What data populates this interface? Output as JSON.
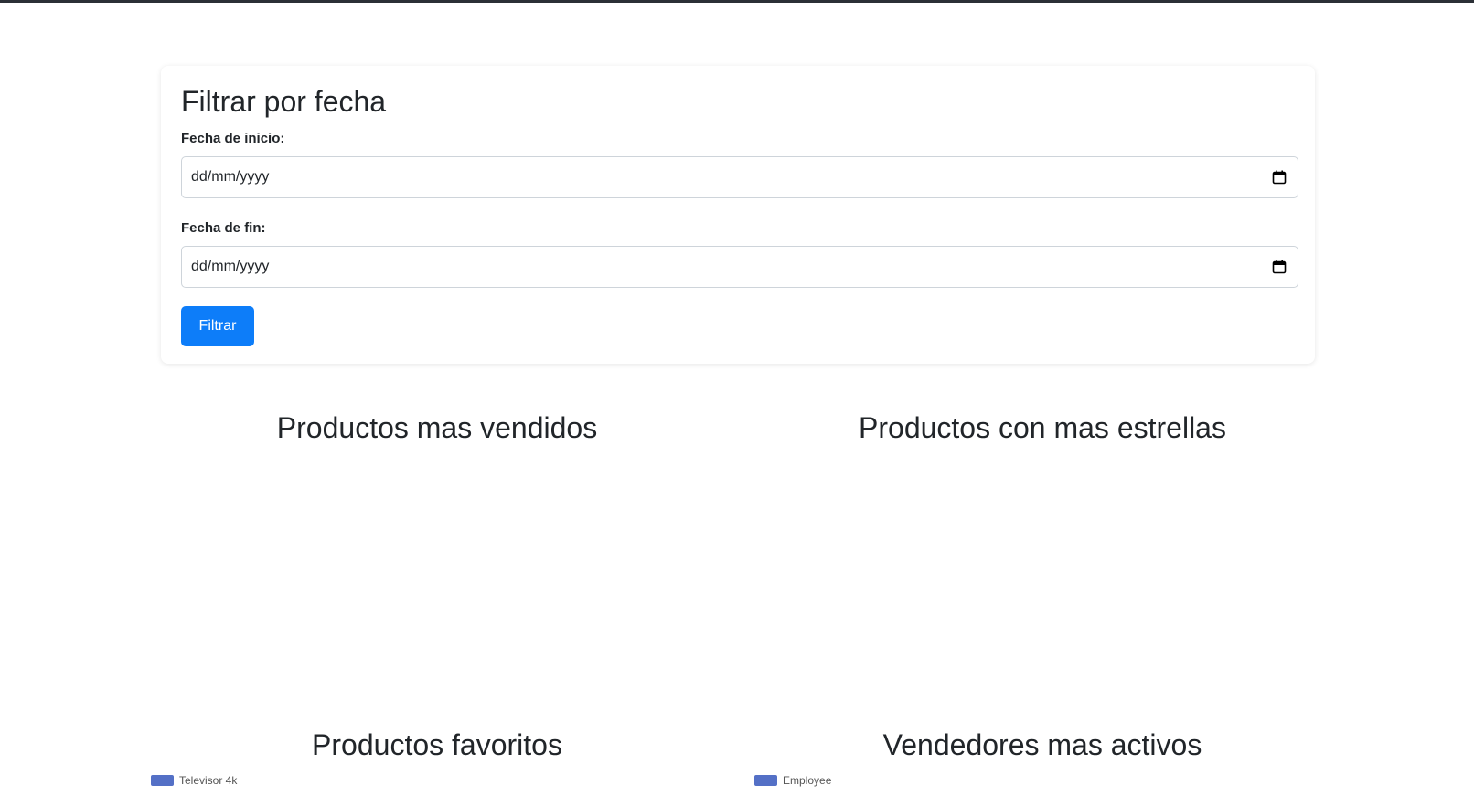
{
  "filter": {
    "title": "Filtrar por fecha",
    "start_label": "Fecha de inicio:",
    "start_placeholder": "dd/mm/yyyy",
    "end_label": "Fecha de fin:",
    "end_placeholder": "dd/mm/yyyy",
    "button_label": "Filtrar",
    "button_color": "#0d7df9"
  },
  "sections": {
    "best_sellers": "Productos mas vendidos",
    "most_stars": "Productos con mas estrellas",
    "favorites": "Productos favoritos",
    "active_sellers": "Vendedores mas activos"
  },
  "legends": {
    "favorites_series": "Televisor 4k",
    "active_sellers_series": "Employee",
    "series_color": "#5470c6"
  },
  "icons": {
    "calendar": "calendar-icon"
  }
}
